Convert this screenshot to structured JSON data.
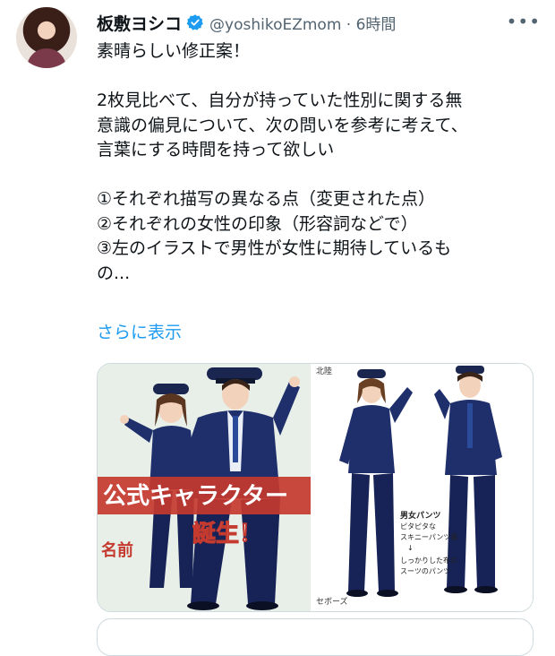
{
  "tweet": {
    "author_name": "板敷ヨシコ",
    "handle": "@yoshikoEZmom",
    "separator": "·",
    "time": "6時間",
    "more_label": "•••",
    "text_lines": [
      "素晴らしい修正案！",
      "",
      "2枚見比べて、自分が持っていた性別に関する無",
      "意識の偏見について、次の問いを参考に考えて、",
      "言葉にする時間を持って欲しい",
      "",
      "①それぞれ描写の異なる点（変更された点）",
      "②それぞれの女性の印象（形容詞などで）",
      "③左のイラストで男性が女性に期待しているも",
      "の..."
    ],
    "show_more": "さらに表示"
  },
  "media": {
    "left_image": {
      "banner_line1": "公式キャラクター",
      "banner_line2": "誕生！",
      "name_label": "名前"
    },
    "right_image": {
      "corner_tl": "北陸",
      "corner_bl": "セボーズ",
      "annotation_title": "男女パンツ",
      "annotation_lines": [
        "ピタピタな",
        "スキニーパンツ風",
        "↓",
        "しっかりした布の",
        "スーツのパンツ"
      ]
    }
  },
  "colors": {
    "link": "#1d9bf0",
    "verified": "#1d9bf0",
    "secondary_text": "#536471",
    "uniform": "#1f2f6b",
    "left_bg": "#e8efe9",
    "banner": "#c43a2f"
  }
}
